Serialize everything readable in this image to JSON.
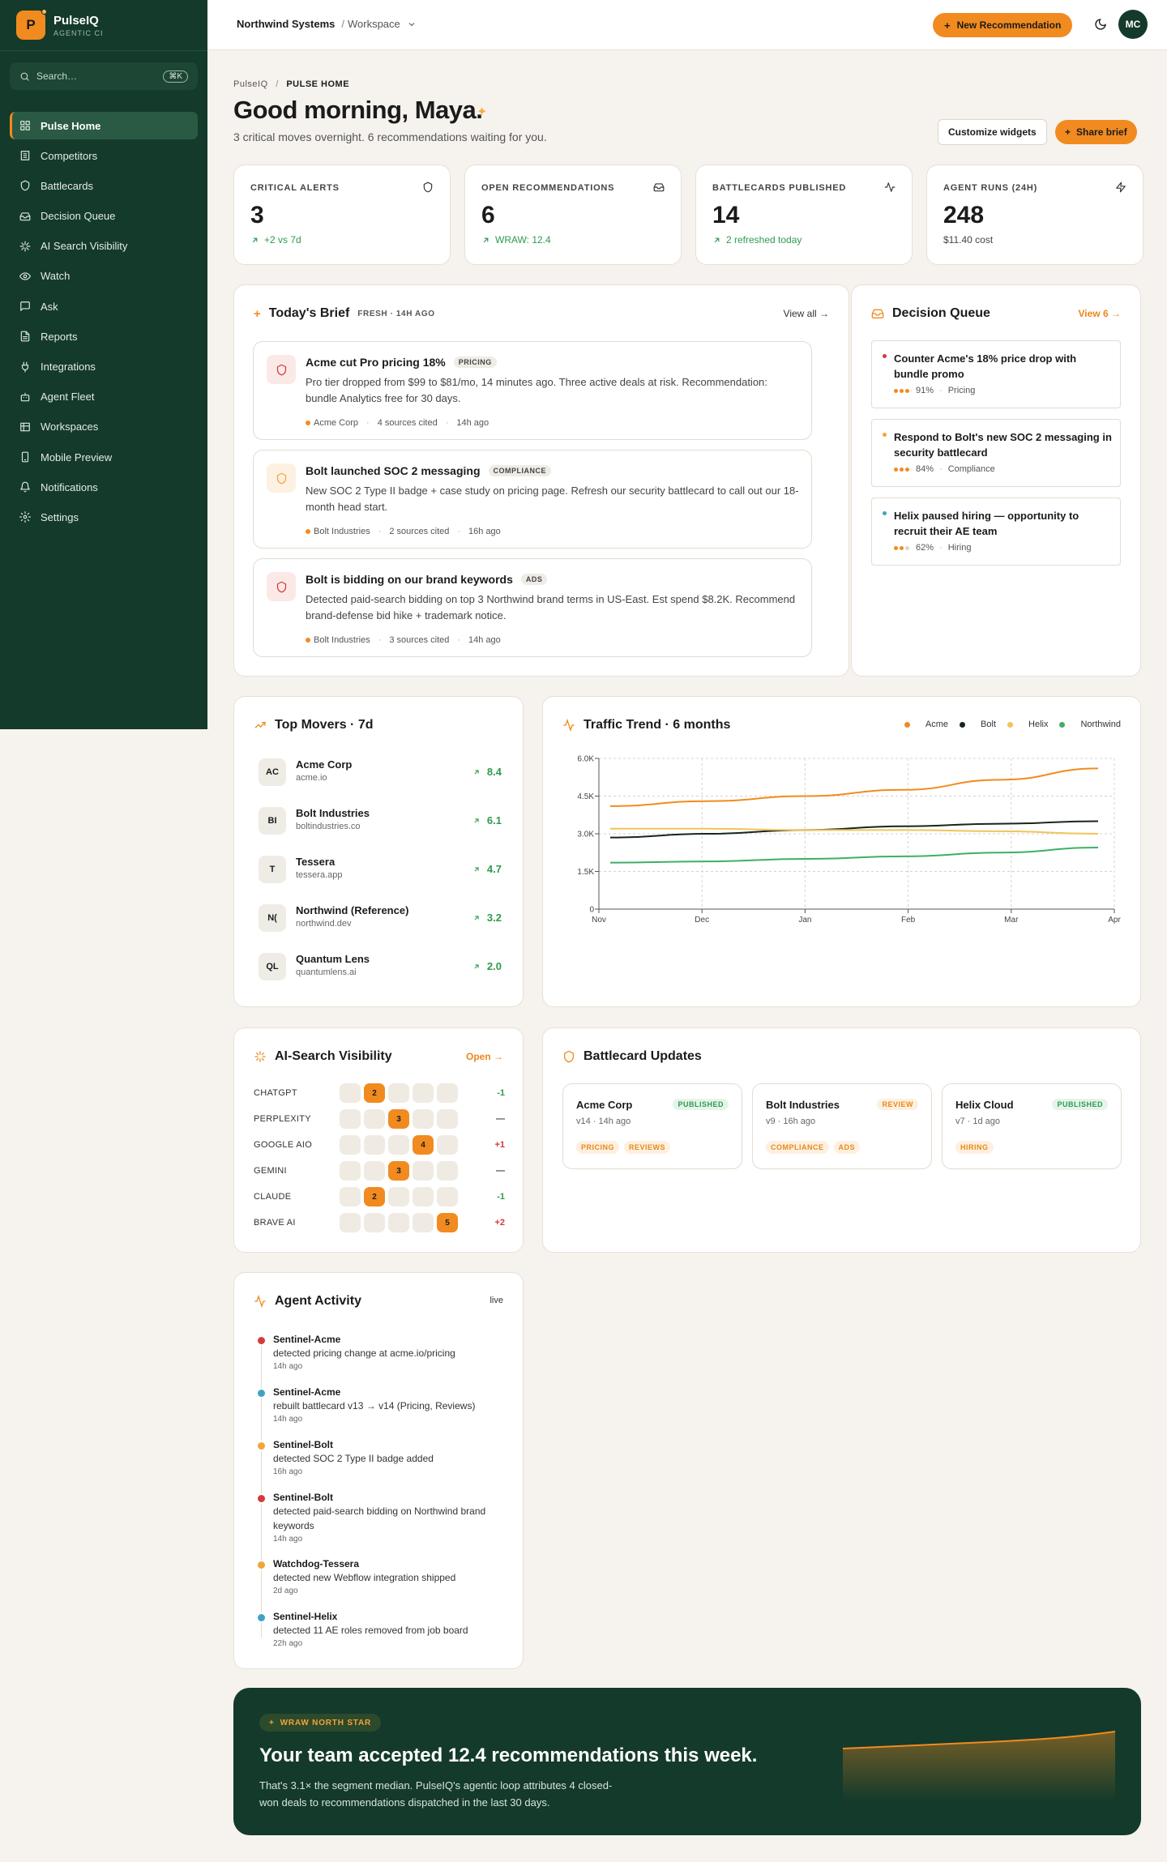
{
  "brand": {
    "name": "PulseIQ",
    "sub": "AGENTIC CI",
    "logo": "P"
  },
  "search": {
    "placeholder": "Search…",
    "shortcut": "⌘K"
  },
  "nav": [
    {
      "label": "Pulse Home",
      "icon": "grid-icon",
      "active": true
    },
    {
      "label": "Competitors",
      "icon": "building-icon"
    },
    {
      "label": "Battlecards",
      "icon": "shield-icon"
    },
    {
      "label": "Decision Queue",
      "icon": "inbox-icon"
    },
    {
      "label": "AI Search Visibility",
      "icon": "sparkle-icon"
    },
    {
      "label": "Watch",
      "icon": "eye-icon"
    },
    {
      "label": "Ask",
      "icon": "chat-icon"
    },
    {
      "label": "Reports",
      "icon": "file-icon"
    },
    {
      "label": "Integrations",
      "icon": "plug-icon"
    },
    {
      "label": "Agent Fleet",
      "icon": "bot-icon"
    },
    {
      "label": "Workspaces",
      "icon": "org-icon"
    },
    {
      "label": "Mobile Preview",
      "icon": "phone-icon"
    },
    {
      "label": "Notifications",
      "icon": "bell-icon"
    },
    {
      "label": "Settings",
      "icon": "gear-icon"
    }
  ],
  "topbar": {
    "org": "Northwind Systems",
    "sep": "/",
    "workspace": "Workspace",
    "new_button": "New Recommendation",
    "avatar": "MC"
  },
  "page": {
    "crumb_root": "PulseIQ",
    "crumb_sep": "/",
    "crumb_current": "PULSE HOME",
    "greeting": "Good morning, Maya.",
    "subtitle": "3 critical moves overnight. 6 recommendations waiting for you.",
    "customize": "Customize widgets",
    "share": "Share brief"
  },
  "stats": [
    {
      "label": "CRITICAL ALERTS",
      "value": "3",
      "sub": "+2 vs 7d",
      "icon": "shield-icon",
      "trend": true
    },
    {
      "label": "OPEN RECOMMENDATIONS",
      "value": "6",
      "sub": "WRAW: 12.4",
      "icon": "inbox-icon",
      "trend": true
    },
    {
      "label": "BATTLECARDS PUBLISHED",
      "value": "14",
      "sub": "2 refreshed today",
      "icon": "activity-icon",
      "trend": true
    },
    {
      "label": "AGENT RUNS (24H)",
      "value": "248",
      "sub": "$11.40 cost",
      "icon": "bolt-icon",
      "trend": false
    }
  ],
  "brief": {
    "title": "Today's Brief",
    "tag": "FRESH · 14H AGO",
    "link": "View all →",
    "items": [
      {
        "title": "Acme cut Pro pricing 18%",
        "pill": "PRICING",
        "body": "Pro tier dropped from $99 to $81/mo, 14 minutes ago. Three active deals at risk. Recommendation: bundle Analytics free for 30 days.",
        "company": "Acme Corp",
        "sources": "4 sources cited",
        "time": "14h ago",
        "severity": "critical",
        "color": "#d63a3a",
        "bg": "#fbe9e7"
      },
      {
        "title": "Bolt launched SOC 2 messaging",
        "pill": "COMPLIANCE",
        "body": "New SOC 2 Type II badge + case study on pricing page. Refresh our security battlecard to call out our 18-month head start.",
        "company": "Bolt Industries",
        "sources": "2 sources cited",
        "time": "16h ago",
        "severity": "warning",
        "color": "#f0a63a",
        "bg": "#fdf1e1"
      },
      {
        "title": "Bolt is bidding on our brand keywords",
        "pill": "ADS",
        "body": "Detected paid-search bidding on top 3 Northwind brand terms in US-East. Est spend $8.2K. Recommend brand-defense bid hike + trademark notice.",
        "company": "Bolt Industries",
        "sources": "3 sources cited",
        "time": "14h ago",
        "severity": "critical",
        "color": "#d63a3a",
        "bg": "#fbe9e7"
      }
    ]
  },
  "queue": {
    "title": "Decision Queue",
    "link": "View 6 →",
    "items": [
      {
        "title": "Counter Acme's 18% price drop with bundle promo",
        "confidence": "91%",
        "category": "Pricing",
        "bullet": "#d63a3a",
        "dots": [
          "#f18b1f",
          "#f18b1f",
          "#f18b1f"
        ]
      },
      {
        "title": "Respond to Bolt's new SOC 2 messaging in security battlecard",
        "confidence": "84%",
        "category": "Compliance",
        "bullet": "#f0a63a",
        "dots": [
          "#f18b1f",
          "#f18b1f",
          "#f18b1f"
        ]
      },
      {
        "title": "Helix paused hiring — opportunity to recruit their AE team",
        "confidence": "62%",
        "category": "Hiring",
        "bullet": "#3fa3c4",
        "dots": [
          "#f18b1f",
          "#f18b1f",
          "#ddd6cb"
        ]
      }
    ]
  },
  "movers": {
    "title": "Top Movers · 7d",
    "items": [
      {
        "badge": "AC",
        "name": "Acme Corp",
        "domain": "acme.io",
        "value": "8.4"
      },
      {
        "badge": "BI",
        "name": "Bolt Industries",
        "domain": "boltindustries.co",
        "value": "6.1"
      },
      {
        "badge": "T",
        "name": "Tessera",
        "domain": "tessera.app",
        "value": "4.7"
      },
      {
        "badge": "N(",
        "name": "Northwind (Reference)",
        "domain": "northwind.dev",
        "value": "3.2"
      },
      {
        "badge": "QL",
        "name": "Quantum Lens",
        "domain": "quantumlens.ai",
        "value": "2.0"
      }
    ]
  },
  "chart_data": {
    "type": "line",
    "title": "Traffic Trend · 6 months",
    "x": [
      "Nov",
      "Dec",
      "Jan",
      "Feb",
      "Mar",
      "Apr"
    ],
    "ylim": [
      0,
      6000
    ],
    "yticks": [
      "0",
      "1.5K",
      "3.0K",
      "4.5K",
      "6.0K"
    ],
    "grid": true,
    "legend": "top-right",
    "series": [
      {
        "name": "Acme",
        "color": "#f18b1f",
        "values": [
          4100,
          4300,
          4500,
          4750,
          5150,
          5600
        ]
      },
      {
        "name": "Bolt",
        "color": "#17251d",
        "values": [
          2850,
          3000,
          3150,
          3300,
          3400,
          3500
        ]
      },
      {
        "name": "Helix",
        "color": "#f2c35a",
        "values": [
          3200,
          3200,
          3150,
          3150,
          3100,
          3000
        ]
      },
      {
        "name": "Northwind",
        "color": "#3fae66",
        "values": [
          1850,
          1900,
          2000,
          2100,
          2250,
          2450
        ]
      }
    ]
  },
  "visibility": {
    "title": "AI-Search Visibility",
    "link": "Open →",
    "rows": [
      {
        "engine": "CHATGPT",
        "rank": 2,
        "delta": "-1",
        "tone": "green"
      },
      {
        "engine": "PERPLEXITY",
        "rank": 3,
        "delta": "—",
        "tone": "neutral"
      },
      {
        "engine": "GOOGLE AIO",
        "rank": 4,
        "delta": "+1",
        "tone": "red"
      },
      {
        "engine": "GEMINI",
        "rank": 3,
        "delta": "—",
        "tone": "neutral"
      },
      {
        "engine": "CLAUDE",
        "rank": 2,
        "delta": "-1",
        "tone": "green"
      },
      {
        "engine": "BRAVE AI",
        "rank": 5,
        "delta": "+2",
        "tone": "red"
      }
    ]
  },
  "battlecards": {
    "title": "Battlecard Updates",
    "items": [
      {
        "name": "Acme Corp",
        "status": "PUBLISHED",
        "version": "v14 · 14h ago",
        "tags": [
          "PRICING",
          "REVIEWS"
        ],
        "status_color": "#2e9b4f",
        "status_bg": "#e5f4ea"
      },
      {
        "name": "Bolt Industries",
        "status": "REVIEW",
        "version": "v9 · 16h ago",
        "tags": [
          "COMPLIANCE",
          "ADS"
        ],
        "status_color": "#e9881b",
        "status_bg": "#fdf0e0"
      },
      {
        "name": "Helix Cloud",
        "status": "PUBLISHED",
        "version": "v7 · 1d ago",
        "tags": [
          "HIRING"
        ],
        "status_color": "#2e9b4f",
        "status_bg": "#e5f4ea"
      }
    ]
  },
  "activity": {
    "title": "Agent Activity",
    "tag": "live",
    "items": [
      {
        "agent": "Sentinel-Acme",
        "desc": "detected pricing change at acme.io/pricing",
        "time": "14h ago",
        "color": "#d63a3a"
      },
      {
        "agent": "Sentinel-Acme",
        "desc": "rebuilt battlecard v13 → v14 (Pricing, Reviews)",
        "time": "14h ago",
        "color": "#3fa3c4"
      },
      {
        "agent": "Sentinel-Bolt",
        "desc": "detected SOC 2 Type II badge added",
        "time": "16h ago",
        "color": "#f0a63a"
      },
      {
        "agent": "Sentinel-Bolt",
        "desc": "detected paid-search bidding on Northwind brand keywords",
        "time": "14h ago",
        "color": "#d63a3a"
      },
      {
        "agent": "Watchdog-Tessera",
        "desc": "detected new Webflow integration shipped",
        "time": "2d ago",
        "color": "#f0a63a"
      },
      {
        "agent": "Sentinel-Helix",
        "desc": "detected 11 AE roles removed from job board",
        "time": "22h ago",
        "color": "#3fa3c4"
      }
    ]
  },
  "hero": {
    "pill": "WRAW NORTH STAR",
    "title": "Your team accepted 12.4 recommendations this week.",
    "sub": "That's 3.1× the segment median. PulseIQ's agentic loop attributes 4 closed-won deals to recommendations dispatched in the last 30 days."
  }
}
